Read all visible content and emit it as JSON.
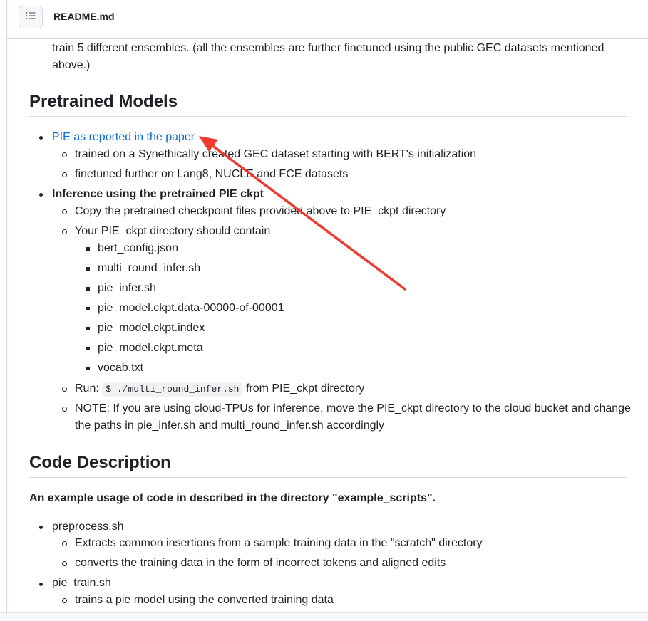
{
  "header": {
    "file_name": "README.md",
    "toc_icon": "list-unordered-icon"
  },
  "intro": {
    "line1": "train 5 different ensembles. (all the ensembles are further finetuned using the public GEC datasets mentioned",
    "line2": "above.)"
  },
  "pretrained": {
    "heading": "Pretrained Models",
    "link": "PIE as reported in the paper",
    "sub1": "trained on a Synethically created GEC dataset starting with BERT's initialization",
    "sub2": "finetuned further on Lang8, NUCLE and FCE datasets",
    "inference_title": "Inference using the pretrained PIE ckpt",
    "copy": "Copy the pretrained checkpoint files provided above to PIE_ckpt directory",
    "contain": "Your PIE_ckpt directory should contain",
    "files": [
      "bert_config.json",
      "multi_round_infer.sh",
      "pie_infer.sh",
      "pie_model.ckpt.data-00000-of-00001",
      "pie_model.ckpt.index",
      "pie_model.ckpt.meta",
      "vocab.txt"
    ],
    "run_prefix": "Run:",
    "run_code": "$ ./multi_round_infer.sh",
    "run_suffix": "from PIE_ckpt directory",
    "note_line1": "NOTE: If you are using cloud-TPUs for inference, move the PIE_ckpt directory to the cloud bucket and change",
    "note_line2": "the paths in pie_infer.sh and multi_round_infer.sh accordingly"
  },
  "code_desc": {
    "heading": "Code Description",
    "summary": "An example usage of code in described in the directory \"example_scripts\".",
    "items": [
      {
        "name": "preprocess.sh",
        "subs": [
          "Extracts common insertions from a sample training data in the \"scratch\" directory",
          "converts the training data in the form of incorrect tokens and aligned edits"
        ]
      },
      {
        "name": "pie_train.sh",
        "subs": [
          "trains a pie model using the converted training data"
        ]
      }
    ]
  },
  "annotation": {
    "arrow_color": "#f03a2e"
  }
}
